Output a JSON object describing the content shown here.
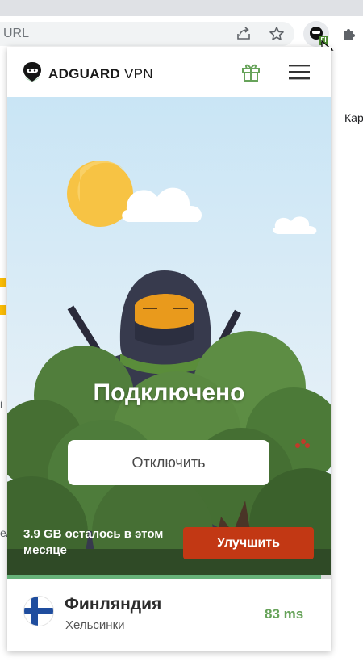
{
  "browser": {
    "url_text": "URL",
    "extension_badge": "FI"
  },
  "background_page": {
    "right_text": "Кар",
    "left_fragment_1": "i",
    "left_fragment_2": "e/"
  },
  "popup": {
    "logo": {
      "brand": "ADGUARD",
      "product": "VPN"
    },
    "status_title": "Подключено",
    "disconnect_label": "Отключить",
    "traffic_text": "3.9 GB осталось в этом месяце",
    "traffic_used_fraction": 0.97,
    "upgrade_label": "Улучшить",
    "location": {
      "country": "Финляндия",
      "city": "Хельсинки",
      "ping": "83 ms",
      "flag_icon": "finland-flag-icon"
    },
    "colors": {
      "accent_green": "#67b279",
      "upgrade_red": "#c23814",
      "ping_green": "#67a35a"
    }
  }
}
